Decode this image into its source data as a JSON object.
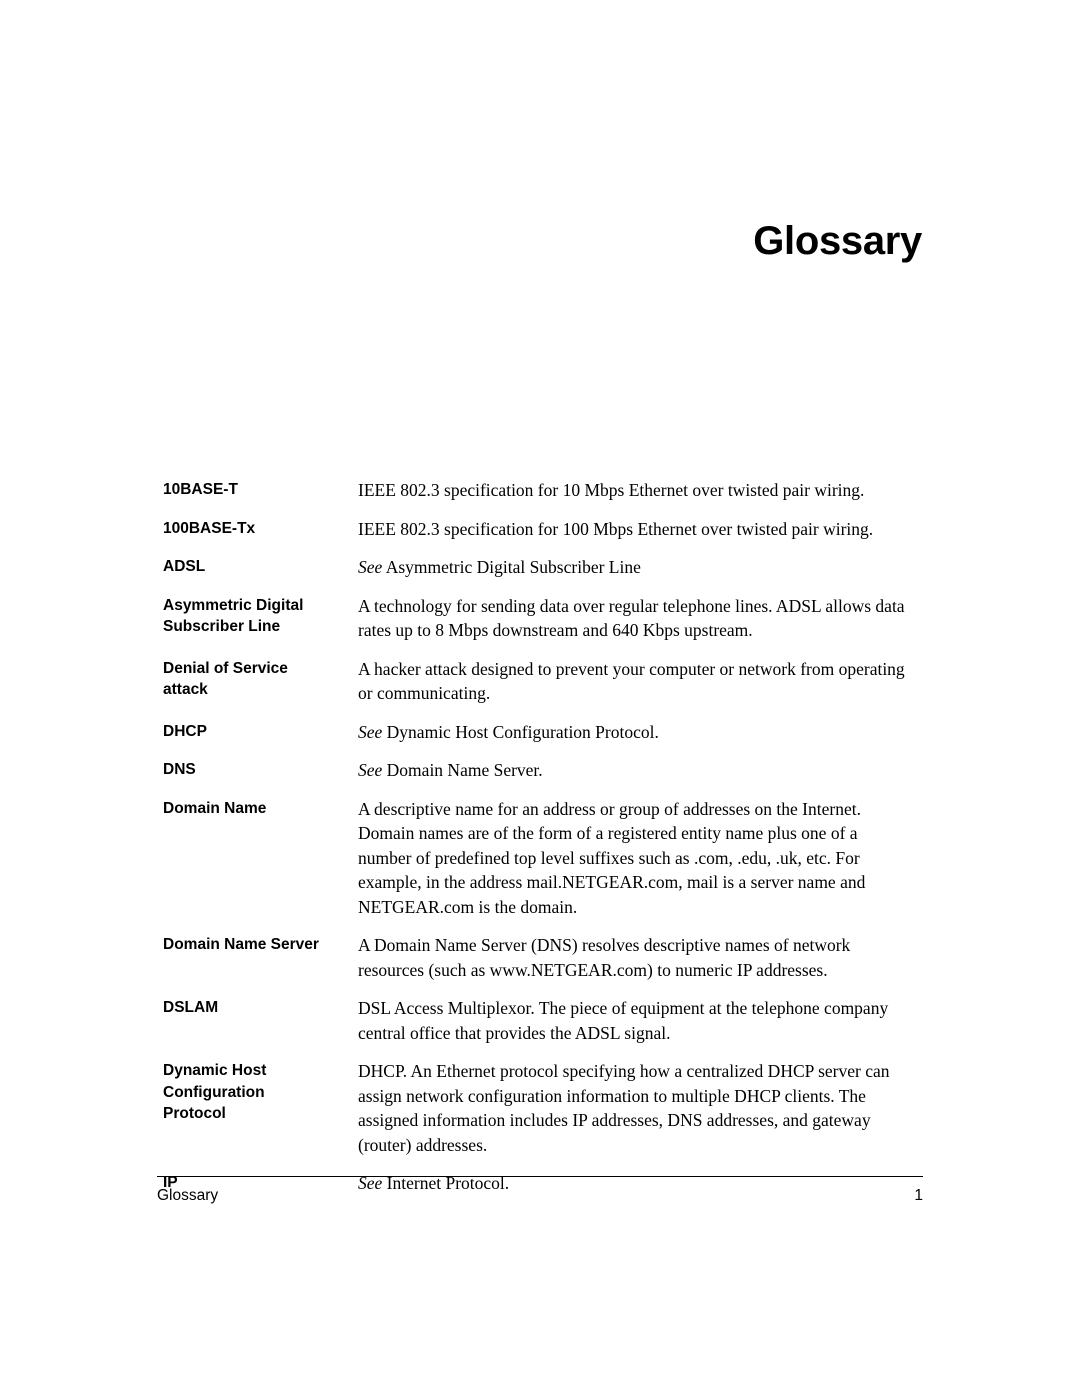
{
  "document": {
    "chapter_title": "Glossary"
  },
  "glossary": {
    "entries": [
      {
        "term_lines": [
          "10BASE-T"
        ],
        "see_prefix": "",
        "def_lines": [
          "IEEE 802.3 specification for 10 Mbps Ethernet over twisted pair wiring."
        ]
      },
      {
        "term_lines": [
          "100BASE-Tx"
        ],
        "see_prefix": "",
        "def_lines": [
          "IEEE 802.3 specification for 100 Mbps Ethernet over twisted pair wiring."
        ]
      },
      {
        "term_lines": [
          "ADSL"
        ],
        "see_prefix": "See",
        "def_lines": [
          "Asymmetric Digital Subscriber Line"
        ]
      },
      {
        "term_lines": [
          "Asymmetric Digital",
          "Subscriber Line"
        ],
        "see_prefix": "",
        "def_lines": [
          "A technology for sending data over regular telephone lines. ADSL allows data",
          "rates up to 8 Mbps downstream and 640 Kbps upstream."
        ]
      },
      {
        "term_lines": [
          "Denial of Service",
          "attack"
        ],
        "see_prefix": "",
        "def_lines": [
          "A hacker attack designed to prevent your computer or network from operating",
          "or communicating."
        ]
      },
      {
        "term_lines": [
          "DHCP"
        ],
        "see_prefix": "See",
        "def_lines": [
          "Dynamic Host Configuration Protocol."
        ]
      },
      {
        "term_lines": [
          "DNS"
        ],
        "see_prefix": "See",
        "def_lines": [
          "Domain Name Server."
        ]
      },
      {
        "term_lines": [
          "Domain Name"
        ],
        "see_prefix": "",
        "def_lines": [
          "A descriptive name for an address or group of addresses on the Internet.",
          "Domain names are of the form of a registered entity name plus one of a",
          "number of predefined top level suffixes such as .com, .edu, .uk, etc. For",
          "example, in the address mail.NETGEAR.com, mail is a server name and",
          "NETGEAR.com is the domain."
        ]
      },
      {
        "term_lines": [
          "Domain Name Server"
        ],
        "see_prefix": "",
        "def_lines": [
          "A Domain Name Server (DNS) resolves descriptive names of network",
          "resources (such as www.NETGEAR.com) to numeric IP addresses."
        ]
      },
      {
        "term_lines": [
          "DSLAM"
        ],
        "see_prefix": "",
        "def_lines": [
          "DSL Access Multiplexor. The piece of equipment at the telephone company",
          "central office that provides the ADSL signal."
        ]
      },
      {
        "term_lines": [
          "Dynamic Host",
          "Configuration",
          "Protocol"
        ],
        "see_prefix": "",
        "def_lines": [
          "DHCP. An Ethernet protocol specifying how a centralized DHCP server can",
          "assign network configuration information to multiple DHCP clients. The",
          "assigned information includes IP addresses, DNS addresses, and gateway",
          "(router) addresses."
        ]
      },
      {
        "term_lines": [
          "IP"
        ],
        "see_prefix": "See",
        "def_lines": [
          "Internet Protocol."
        ]
      }
    ]
  },
  "footer": {
    "left_label": "Glossary",
    "page_number": "1"
  }
}
